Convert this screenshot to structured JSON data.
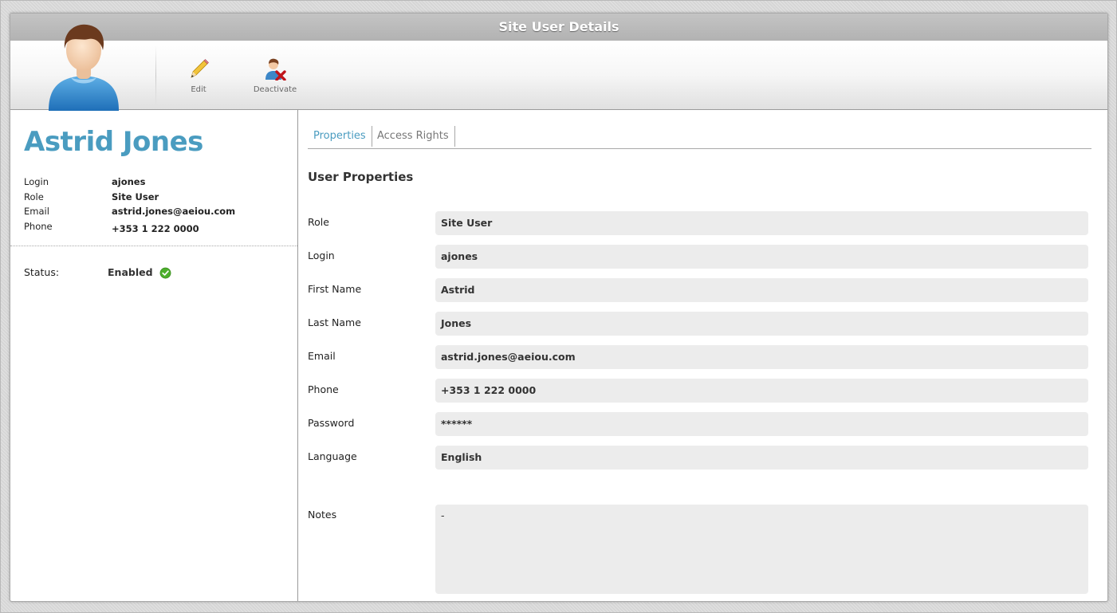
{
  "window": {
    "title": "Site User Details"
  },
  "toolbar": {
    "avatar_icon": "user-avatar-icon",
    "edit_label": "Edit",
    "edit_icon": "pencil-icon",
    "deactivate_label": "Deactivate",
    "deactivate_icon": "user-remove-icon"
  },
  "profile": {
    "name": "Astrid Jones",
    "login_label": "Login",
    "login": "ajones",
    "role_label": "Role",
    "role": "Site User",
    "email_label": "Email",
    "email": "astrid.jones@aeiou.com",
    "phone_label": "Phone",
    "phone": "+353 1 222 0000",
    "status_label": "Status:",
    "status": "Enabled",
    "status_icon": "check-circle-icon"
  },
  "tabs": [
    {
      "label": "Properties",
      "active": true
    },
    {
      "label": "Access Rights",
      "active": false
    }
  ],
  "properties": {
    "section_title": "User Properties",
    "fields": [
      {
        "label": "Role",
        "value": "Site User"
      },
      {
        "label": "Login",
        "value": "ajones"
      },
      {
        "label": "First Name",
        "value": "Astrid"
      },
      {
        "label": "Last Name",
        "value": "Jones"
      },
      {
        "label": "Email",
        "value": "astrid.jones@aeiou.com"
      },
      {
        "label": "Phone",
        "value": "+353 1 222 0000"
      },
      {
        "label": "Password",
        "value": "******"
      },
      {
        "label": "Language",
        "value": "English"
      }
    ],
    "notes_label": "Notes",
    "notes": "-"
  },
  "colors": {
    "accent": "#4a9cc0",
    "titlebar": "#bcbcbc",
    "field_bg": "#ececec",
    "status_ok": "#4caf2c"
  }
}
